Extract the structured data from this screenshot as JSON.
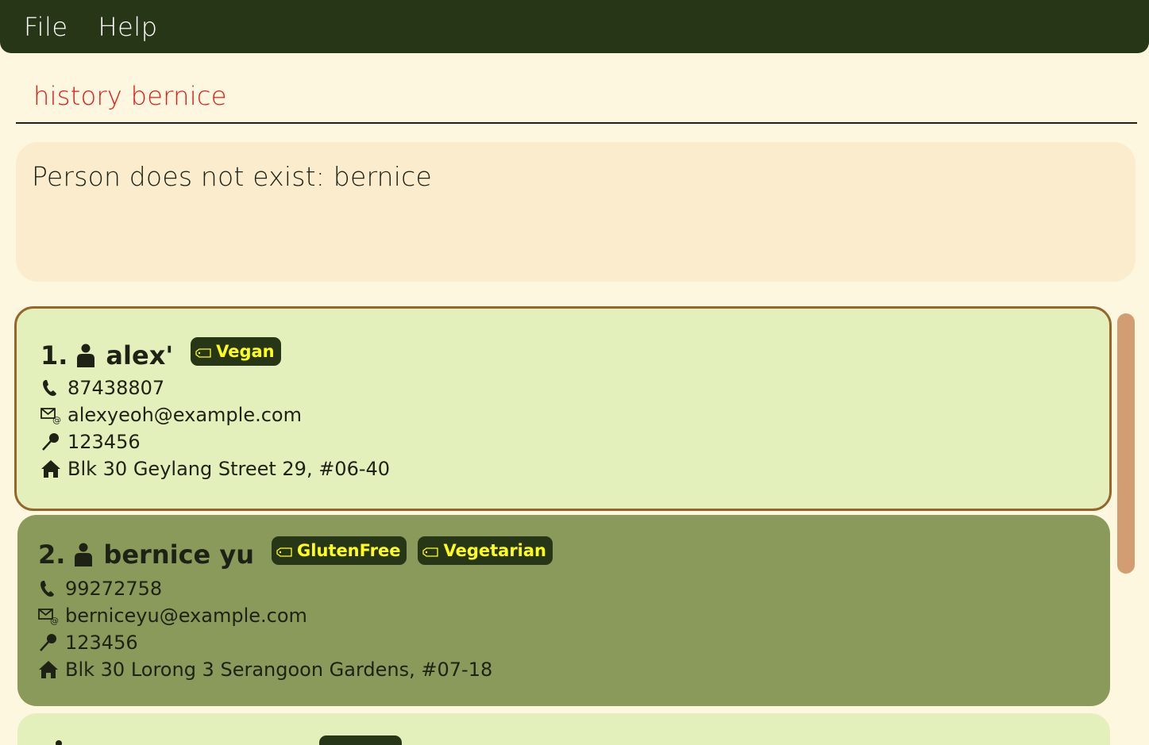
{
  "menu": {
    "file": "File",
    "help": "Help"
  },
  "command": {
    "value": "history bernice",
    "color": "#e01b1b"
  },
  "result": {
    "message": "Person does not exist: bernice"
  },
  "persons": [
    {
      "index": "1.",
      "name": "alex'",
      "tags": [
        "Vegan"
      ],
      "phone": "87438807",
      "email": "alexyeoh@example.com",
      "pin": "123456",
      "address": "Blk 30 Geylang Street 29, #06-40"
    },
    {
      "index": "2.",
      "name": "bernice yu",
      "tags": [
        "GlutenFree",
        "Vegetarian"
      ],
      "phone": "99272758",
      "email": "berniceyu@example.com",
      "pin": "123456",
      "address": "Blk 30 Lorong 3 Serangoon Gardens, #07-18"
    }
  ],
  "icons": {
    "person": "person-icon",
    "tag": "tag-icon",
    "phone": "phone-icon",
    "email": "email-icon",
    "pin": "pin-icon",
    "address": "home-icon"
  },
  "colors": {
    "menubar": "#283618",
    "background": "#fdf7df",
    "result_box": "#faeccd",
    "card_light": "#e3f0bc",
    "card_dark": "#8a9a5b",
    "card_selected_border": "#95662a",
    "tag_bg": "#283618",
    "tag_text": "#ffff1a",
    "scrollbar": "#d29d72"
  }
}
